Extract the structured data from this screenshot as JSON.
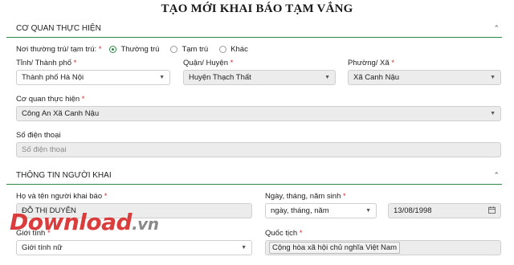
{
  "page_title": "TẠO MỚI KHAI BÁO TẠM VẮNG",
  "section1": {
    "heading": "CƠ QUAN THỰC HIỆN",
    "residence_type_label": "Nơi thường trú/ tạm trú:",
    "residence_options": [
      {
        "label": "Thường trú",
        "selected": true
      },
      {
        "label": "Tạm trú",
        "selected": false
      },
      {
        "label": "Khác",
        "selected": false
      }
    ],
    "province_label": "Tỉnh/ Thành phố",
    "province_value": "Thành phố Hà Nội",
    "district_label": "Quận/ Huyện",
    "district_value": "Huyện Thạch Thất",
    "ward_label": "Phường/ Xã",
    "ward_value": "Xã Canh Nậu",
    "agency_label": "Cơ quan thực hiện",
    "agency_value": "Công An Xã Canh Nậu",
    "phone_label": "Số điện thoại",
    "phone_placeholder": "Số điện thoại"
  },
  "section2": {
    "heading": "THÔNG TIN NGƯỜI KHAI",
    "name_label": "Họ và tên người khai báo",
    "name_value": "ĐỖ THỊ DUYÊN",
    "dob_label": "Ngày, tháng, năm sinh",
    "dob_format_value": "ngày, tháng, năm",
    "dob_value": "13/08/1998",
    "gender_label": "Giới tính",
    "gender_value": "Giới tính nữ",
    "nationality_label": "Quốc tịch",
    "nationality_value": "Cộng hòa xã hội chủ nghĩa Việt Nam"
  },
  "required_mark": "*",
  "watermark": {
    "main": "Download",
    "suffix": ".vn"
  },
  "colors": {
    "accent": "#2e8b46",
    "required": "#d32f2f"
  }
}
